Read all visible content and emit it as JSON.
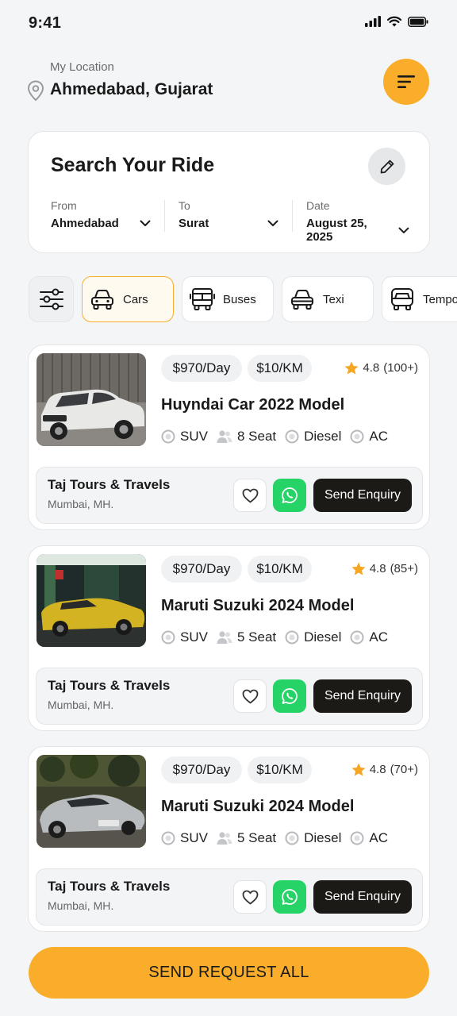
{
  "status": {
    "time": "9:41"
  },
  "location": {
    "label": "My Location",
    "value": "Ahmedabad, Gujarat"
  },
  "search": {
    "title": "Search Your Ride",
    "from_label": "From",
    "from_value": "Ahmedabad",
    "to_label": "To",
    "to_value": "Surat",
    "date_label": "Date",
    "date_value": "August 25, 2025"
  },
  "categories": [
    {
      "label": "Cars",
      "active": true
    },
    {
      "label": "Buses",
      "active": false
    },
    {
      "label": "Texi",
      "active": false
    },
    {
      "label": "Tempo",
      "active": false
    }
  ],
  "listings": [
    {
      "price_day": "$970/Day",
      "price_km": "$10/KM",
      "rating": "4.8",
      "reviews": "(100+)",
      "title": "Huyndai Car 2022 Model",
      "specs": {
        "type": "SUV",
        "seats": "8 Seat",
        "fuel": "Diesel",
        "ac": "AC"
      },
      "dealer": "Taj Tours & Travels",
      "dealer_loc": "Mumbai, MH.",
      "enquiry_label": "Send Enquiry"
    },
    {
      "price_day": "$970/Day",
      "price_km": "$10/KM",
      "rating": "4.8",
      "reviews": "(85+)",
      "title": "Maruti Suzuki 2024 Model",
      "specs": {
        "type": "SUV",
        "seats": "5 Seat",
        "fuel": "Diesel",
        "ac": "AC"
      },
      "dealer": "Taj Tours & Travels",
      "dealer_loc": "Mumbai, MH.",
      "enquiry_label": "Send Enquiry"
    },
    {
      "price_day": "$970/Day",
      "price_km": "$10/KM",
      "rating": "4.8",
      "reviews": "(70+)",
      "title": "Maruti Suzuki 2024 Model",
      "specs": {
        "type": "SUV",
        "seats": "5 Seat",
        "fuel": "Diesel",
        "ac": "AC"
      },
      "dealer": "Taj Tours & Travels",
      "dealer_loc": "Mumbai, MH.",
      "enquiry_label": "Send Enquiry"
    }
  ],
  "footer": {
    "send_all_label": "SEND REQUEST ALL"
  },
  "colors": {
    "accent": "#f9ad2b",
    "whatsapp": "#25d366",
    "dark": "#1c1a17",
    "star": "#f5a623"
  }
}
